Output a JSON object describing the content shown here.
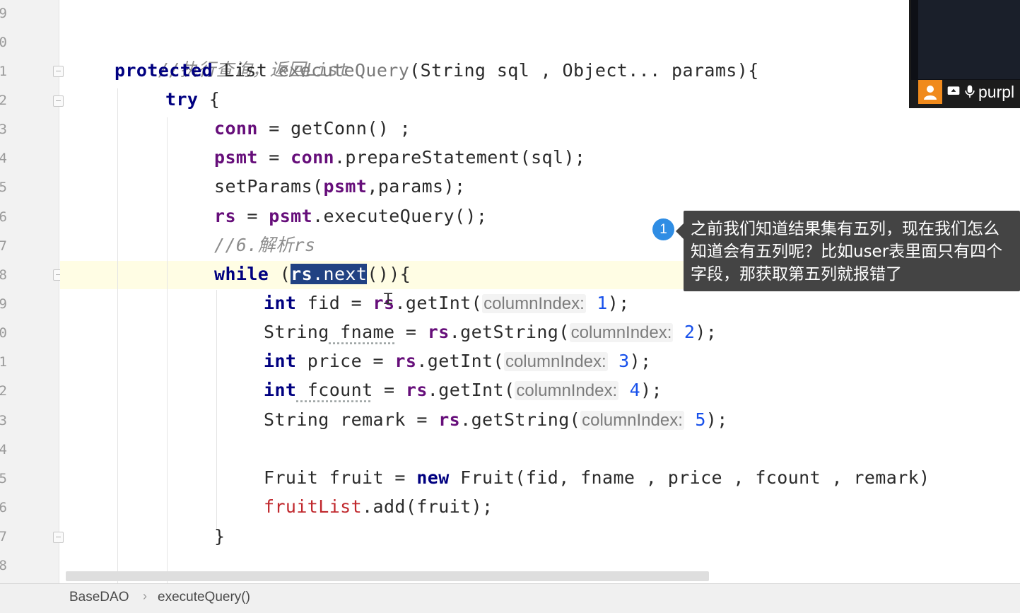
{
  "gutter": {
    "line_numbers": [
      "9",
      "0",
      "1",
      "2",
      "3",
      "4",
      "5",
      "6",
      "7",
      "8",
      "9",
      "0",
      "1",
      "2",
      "3",
      "4",
      "5",
      "6",
      "7",
      "8"
    ]
  },
  "code": {
    "comment_query": "//执行查询，返回List",
    "sig_protected": "protected",
    "sig_type": "List",
    "sig_method": "executeQuery",
    "sig_params": "(String sql , Object... params){",
    "try_kw": "try",
    "try_brace": " {",
    "conn_field": "conn",
    "conn_rest": " = getConn() ;",
    "psmt_field": "psmt",
    "psmt_eq": " = ",
    "psmt_conn": "conn",
    "psmt_rest": ".prepareStatement(sql);",
    "setparams_a": "setParams(",
    "setparams_field": "psmt",
    "setparams_b": ",params);",
    "rs_field": "rs",
    "rs_eq": " = ",
    "rs_psmt": "psmt",
    "rs_rest": ".executeQuery();",
    "comment_parse": "//6.解析rs",
    "while_kw": "while",
    "while_open": " (",
    "while_sel_field": "rs",
    "while_sel_rest": ".next",
    "while_close": "()){",
    "line_fid": {
      "type": "int",
      "name": " fid = ",
      "obj": "rs",
      "call": ".getInt(",
      "hint": "columnIndex:",
      "num": "1",
      "end": ");"
    },
    "line_fname": {
      "type": "String",
      "name": " fname",
      "eq": " = ",
      "obj": "rs",
      "call": ".getString(",
      "hint": "columnIndex:",
      "num": "2",
      "end": ");"
    },
    "line_price": {
      "type": "int",
      "name": " price = ",
      "obj": "rs",
      "call": ".getInt(",
      "hint": "columnIndex:",
      "num": "3",
      "end": ");"
    },
    "line_fcount": {
      "type": "int",
      "name": " fcount",
      "eq": " = ",
      "obj": "rs",
      "call": ".getInt(",
      "hint": "columnIndex:",
      "num": "4",
      "end": ");"
    },
    "line_remark": {
      "type": "String",
      "name": " remark = ",
      "obj": "rs",
      "call": ".getString(",
      "hint": "columnIndex:",
      "num": "5",
      "end": ");"
    },
    "fruit_a": "Fruit fruit = ",
    "fruit_new": "new",
    "fruit_b": " Fruit(fid, fname , price , fcount , remark)",
    "list_field": "fruitList",
    "list_rest": ".add(fruit);",
    "close_brace": "}"
  },
  "status_bar": {
    "crumb_class": "BaseDAO",
    "crumb_sep": "›",
    "crumb_method": "executeQuery()"
  },
  "annotation": {
    "number": "1",
    "text": "之前我们知道结果集有五列，现在我们怎么知道会有五列呢？比如user表里面只有四个字段，那获取第五列就报错了"
  },
  "video_overlay": {
    "participant_name": "purpl"
  },
  "colors": {
    "keyword": "#000080",
    "field": "#660e7a",
    "selection": "#214283",
    "current_line": "#fffde4",
    "annotation_bg": "#444444",
    "annotation_badge": "#2f8de4"
  }
}
